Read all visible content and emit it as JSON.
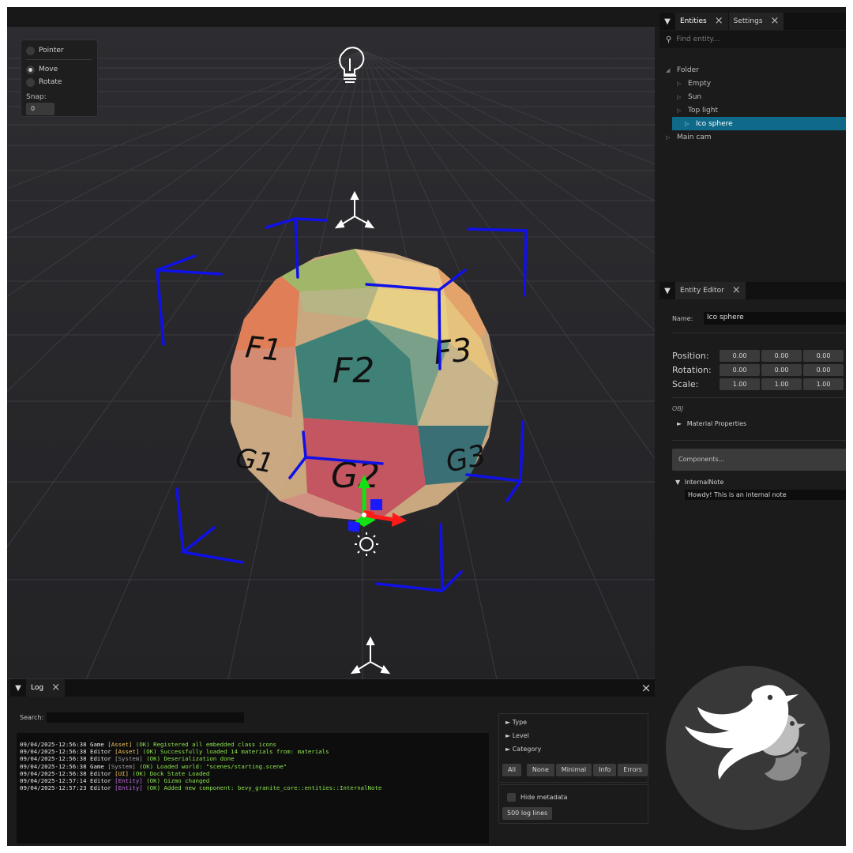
{
  "viewport": {
    "gizmo_modes": [
      {
        "label": "Pointer",
        "selected": false
      },
      {
        "label": "Move",
        "selected": true
      },
      {
        "label": "Rotate",
        "selected": false
      }
    ],
    "snap_label": "Snap:",
    "snap_value": "0",
    "icons": [
      "lightbulb-icon",
      "sun-icon",
      "axes-icon"
    ],
    "sphere_labels": [
      "F1",
      "F2",
      "F3",
      "G1",
      "G2",
      "G3"
    ]
  },
  "entities_panel": {
    "tabs": [
      {
        "label": "Entities",
        "active": true
      },
      {
        "label": "Settings",
        "active": false
      }
    ],
    "search_placeholder": "Find entity...",
    "tree": [
      {
        "label": "Folder",
        "expanded": true,
        "selected": false
      },
      {
        "label": "Empty",
        "selected": false
      },
      {
        "label": "Sun",
        "selected": false
      },
      {
        "label": "Top light",
        "selected": false
      },
      {
        "label": "Ico sphere",
        "selected": true
      },
      {
        "label": "Main cam",
        "selected": false
      }
    ]
  },
  "entity_editor": {
    "tab_label": "Entity Editor",
    "name_label": "Name:",
    "name_value": "Ico sphere",
    "position_label": "Position:",
    "position": [
      "0.00",
      "0.00",
      "0.00"
    ],
    "rotation_label": "Rotation:",
    "rotation": [
      "0.00",
      "0.00",
      "0.00"
    ],
    "scale_label": "Scale:",
    "scale": [
      "1.00",
      "1.00",
      "1.00"
    ],
    "obj_label": "OBJ",
    "material_properties": "Material Properties",
    "components_button": "Components...",
    "internal_note_label": "InternalNote",
    "internal_note_value": "Howdy! This is an internal note"
  },
  "log_panel": {
    "tab_label": "Log",
    "search_label": "Search:",
    "lines": [
      {
        "ts": "09/04/2025-12:56:38",
        "src": "Game",
        "cat": "[Asset]",
        "cat_class": "cat-asset",
        "status": "(OK)",
        "msg": "Registered all embedded class icons"
      },
      {
        "ts": "09/04/2025-12:56:38",
        "src": "Editor",
        "cat": "[Asset]",
        "cat_class": "cat-asset",
        "status": "(OK)",
        "msg": "Successfully loaded 14 materials from: materials"
      },
      {
        "ts": "09/04/2025-12:56:38",
        "src": "Editor",
        "cat": "[System]",
        "cat_class": "cat-system",
        "status": "(OK)",
        "msg": "Deserialization done"
      },
      {
        "ts": "09/04/2025-12:56:38",
        "src": "Game",
        "cat": "[System]",
        "cat_class": "cat-system",
        "status": "(OK)",
        "msg": "Loaded world: \"scenes/starting.scene\""
      },
      {
        "ts": "09/04/2025-12:56:38",
        "src": "Editor",
        "cat": "[UI]",
        "cat_class": "cat-ui",
        "status": "(OK)",
        "msg": "Dock State Loaded"
      },
      {
        "ts": "09/04/2025-12:57:14",
        "src": "Editor",
        "cat": "[Entity]",
        "cat_class": "cat-entity",
        "status": "(OK)",
        "msg": "Gizmo changed"
      },
      {
        "ts": "09/04/2025-12:57:23",
        "src": "Editor",
        "cat": "[Entity]",
        "cat_class": "cat-entity",
        "status": "(OK)",
        "msg": "Added new component: bevy_granite_core::entities::InternalNote"
      }
    ],
    "filters": [
      "Type",
      "Level",
      "Category"
    ],
    "level_buttons": [
      "All",
      "None",
      "Minimal",
      "Info",
      "Errors"
    ],
    "hide_metadata": "Hide metadata",
    "log_lines_button": "500 log lines"
  },
  "colors": {
    "selection": "#0f6a8a",
    "bbox_blue": "#1010e8",
    "axis_red": "#ff1a1a",
    "axis_green": "#14e014",
    "axis_blue": "#1a1aff"
  }
}
